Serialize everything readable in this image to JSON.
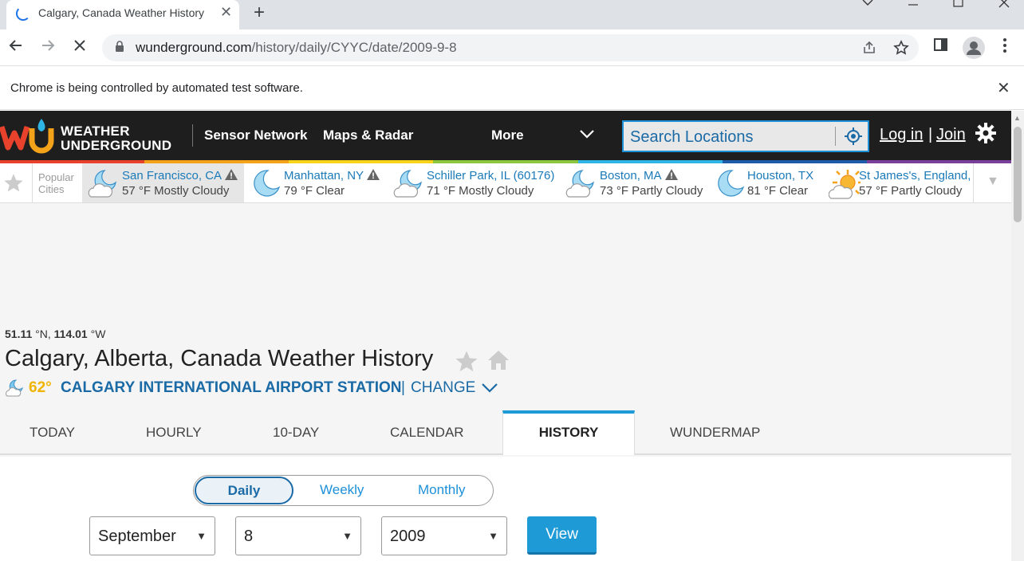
{
  "browser": {
    "tab_title": "Calgary, Canada Weather History",
    "new_tab": "+",
    "tab_close": "✕",
    "url_host": "wunderground.com",
    "url_path": "/history/daily/CYYC/date/2009-9-8",
    "infobar_text": "Chrome is being controlled by automated test software.",
    "infobar_close": "✕"
  },
  "header": {
    "logo_line1": "WEATHER",
    "logo_line2": "UNDERGROUND",
    "nav": [
      "Sensor Network",
      "Maps & Radar",
      "More"
    ],
    "search_placeholder": "Search Locations",
    "login": "Log in",
    "separator": "|",
    "join": "Join",
    "stripe_colors": [
      "#e8412c",
      "#f5a21b",
      "#f7d31a",
      "#8cc63f",
      "#2fb4e6",
      "#1e5ba8",
      "#7a3f9b"
    ]
  },
  "cities": {
    "label_line1": "Popular",
    "label_line2": "Cities",
    "items": [
      {
        "name": "San Francisco, CA",
        "cond": "57 °F Mostly Cloudy",
        "icon": "moon-cloud-icon",
        "alert": true
      },
      {
        "name": "Manhattan, NY",
        "cond": "79 °F Clear",
        "icon": "moon-icon",
        "alert": true
      },
      {
        "name": "Schiller Park, IL (60176)",
        "cond": "71 °F Mostly Cloudy",
        "icon": "moon-cloud-icon",
        "alert": false
      },
      {
        "name": "Boston, MA",
        "cond": "73 °F Partly Cloudy",
        "icon": "moon-cloud-icon",
        "alert": true
      },
      {
        "name": "Houston, TX",
        "cond": "81 °F Clear",
        "icon": "moon-icon",
        "alert": false
      },
      {
        "name": "St James's, England,",
        "cond": "57 °F Partly Cloudy",
        "icon": "sun-cloud-icon",
        "alert": false
      }
    ]
  },
  "location": {
    "lat": "51.11",
    "lat_unit": " °N, ",
    "lon": "114.01",
    "lon_unit": " °W",
    "title": "Calgary, Alberta, Canada Weather History",
    "temp": "62°",
    "station": "CALGARY INTERNATIONAL AIRPORT STATION",
    "sep": "|",
    "change": "CHANGE"
  },
  "tabs": [
    "TODAY",
    "HOURLY",
    "10-DAY",
    "CALENDAR",
    "HISTORY",
    "WUNDERMAP"
  ],
  "history": {
    "modes": [
      "Daily",
      "Weekly",
      "Monthly"
    ],
    "month": "September",
    "day": "8",
    "year": "2009",
    "view_label": "View"
  }
}
